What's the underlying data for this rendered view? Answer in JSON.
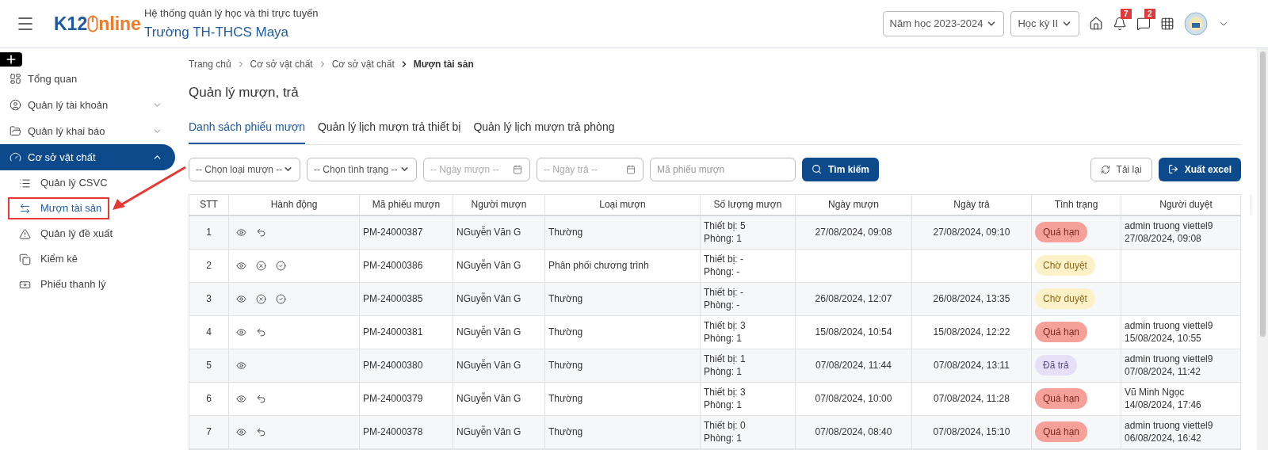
{
  "header": {
    "logo": {
      "part_1": "K12",
      "part_2": "nline"
    },
    "system_name": "Hệ thống quản lý học và thi trực tuyến",
    "school_name": "Trường TH-THCS Maya",
    "year_select": "Năm học 2023-2024",
    "term_select": "Học kỳ II",
    "notifications": "7",
    "messages": "2"
  },
  "sidebar": {
    "items": [
      {
        "label": "Tổng quan",
        "selected": false,
        "expandable": false
      },
      {
        "label": "Quản lý tài khoản",
        "selected": false,
        "expandable": true,
        "expanded": false
      },
      {
        "label": "Quản lý khai báo",
        "selected": false,
        "expandable": true,
        "expanded": false
      },
      {
        "label": "Cơ sở vật chất",
        "selected": true,
        "expandable": true,
        "expanded": true,
        "children": [
          {
            "label": "Quản lý CSVC",
            "selected": false,
            "callout": false
          },
          {
            "label": "Mượn tài sản",
            "selected": true,
            "callout": true
          },
          {
            "label": "Quản lý đề xuất",
            "selected": false,
            "callout": false
          },
          {
            "label": "Kiểm kê",
            "selected": false,
            "callout": false
          },
          {
            "label": "Phiếu thanh lý",
            "selected": false,
            "callout": false
          }
        ]
      }
    ]
  },
  "breadcrumb": [
    "Trang chủ",
    "Cơ sở vật chất",
    "Cơ sở vật chất",
    "Mượn tài sản"
  ],
  "page_title": "Quản lý mượn, trả",
  "tabs": [
    {
      "label": "Danh sách phiếu mượn",
      "selected": true
    },
    {
      "label": "Quản lý lịch mượn trả thiết bị",
      "selected": false
    },
    {
      "label": "Quản lý lịch mượn trả phòng",
      "selected": false
    }
  ],
  "filters": {
    "loan_type": "-- Chọn loại mượn --",
    "status": "-- Chọn tình trạng --",
    "borrow_date": {
      "placeholder": "-- Ngày mượn --"
    },
    "return_date": {
      "placeholder": "-- Ngày trả --"
    },
    "code": {
      "placeholder": "Mã phiếu mượn"
    },
    "search_button": "Tìm kiếm",
    "reload_button": "Tải lại",
    "export_button": "Xuất excel"
  },
  "table": {
    "columns": [
      "STT",
      "Hành động",
      "Mã phiếu mượn",
      "Người mượn",
      "Loại mượn",
      "Số lượng mượn",
      "Ngày mượn",
      "Ngày trả",
      "Tình trạng",
      "Người duyệt"
    ],
    "rows": [
      {
        "stt": "1",
        "actions": [
          {
            "kind": "view"
          },
          {
            "kind": "return"
          }
        ],
        "code": "PM-24000387",
        "borrower": "NGuyễn Văn G",
        "type": "Thường",
        "quantity": [
          "Thiết bị: 5",
          "Phòng: 1"
        ],
        "borrow_date": "27/08/2024, 09:08",
        "return_date": "27/08/2024, 09:10",
        "status": {
          "label": "Quá hạn",
          "kind": "overdue"
        },
        "approver": [
          "admin truong viettel9",
          "27/08/2024, 09:08"
        ]
      },
      {
        "stt": "2",
        "actions": [
          {
            "kind": "view"
          },
          {
            "kind": "reject"
          },
          {
            "kind": "approve"
          }
        ],
        "code": "PM-24000386",
        "borrower": "NGuyễn Văn G",
        "type": "Phân phối chương trình",
        "quantity": [
          "Thiết bị: -",
          "Phòng: -"
        ],
        "status": {
          "label": "Chờ duyệt",
          "kind": "pending"
        }
      },
      {
        "stt": "3",
        "actions": [
          {
            "kind": "view"
          },
          {
            "kind": "reject"
          },
          {
            "kind": "approve"
          }
        ],
        "code": "PM-24000385",
        "borrower": "NGuyễn Văn G",
        "type": "Thường",
        "quantity": [
          "Thiết bị: -",
          "Phòng: -"
        ],
        "borrow_date": "26/08/2024, 12:07",
        "return_date": "26/08/2024, 13:35",
        "status": {
          "label": "Chờ duyệt",
          "kind": "pending"
        }
      },
      {
        "stt": "4",
        "actions": [
          {
            "kind": "view"
          },
          {
            "kind": "return"
          }
        ],
        "code": "PM-24000381",
        "borrower": "NGuyễn Văn G",
        "type": "Thường",
        "quantity": [
          "Thiết bị: 3",
          "Phòng: 1"
        ],
        "borrow_date": "15/08/2024, 10:54",
        "return_date": "15/08/2024, 12:22",
        "status": {
          "label": "Quá hạn",
          "kind": "overdue"
        },
        "approver": [
          "admin truong viettel9",
          "15/08/2024, 10:55"
        ]
      },
      {
        "stt": "5",
        "actions": [
          {
            "kind": "view"
          }
        ],
        "code": "PM-24000380",
        "borrower": "NGuyễn Văn G",
        "type": "Thường",
        "quantity": [
          "Thiết bị: 1",
          "Phòng: 1"
        ],
        "borrow_date": "07/08/2024, 11:44",
        "return_date": "07/08/2024, 13:11",
        "status": {
          "label": "Đã trả",
          "kind": "returned"
        },
        "approver": [
          "admin truong viettel9",
          "07/08/2024, 11:42"
        ]
      },
      {
        "stt": "6",
        "actions": [
          {
            "kind": "view"
          },
          {
            "kind": "return"
          }
        ],
        "code": "PM-24000379",
        "borrower": "NGuyễn Văn G",
        "type": "Thường",
        "quantity": [
          "Thiết bị: 3",
          "Phòng: 1"
        ],
        "borrow_date": "07/08/2024, 10:00",
        "return_date": "07/08/2024, 11:28",
        "status": {
          "label": "Quá hạn",
          "kind": "overdue"
        },
        "approver": [
          "Vũ Minh Ngọc",
          "14/08/2024, 17:46"
        ]
      },
      {
        "stt": "7",
        "actions": [
          {
            "kind": "view"
          },
          {
            "kind": "return"
          }
        ],
        "code": "PM-24000378",
        "borrower": "NGuyễn Văn G",
        "type": "Thường",
        "quantity": [
          "Thiết bị: 0",
          "Phòng: 1"
        ],
        "borrow_date": "07/08/2024, 08:40",
        "return_date": "07/08/2024, 15:10",
        "status": {
          "label": "Quá hạn",
          "kind": "overdue"
        },
        "approver": [
          "admin truong viettel9",
          "06/08/2024, 16:42"
        ]
      }
    ]
  }
}
